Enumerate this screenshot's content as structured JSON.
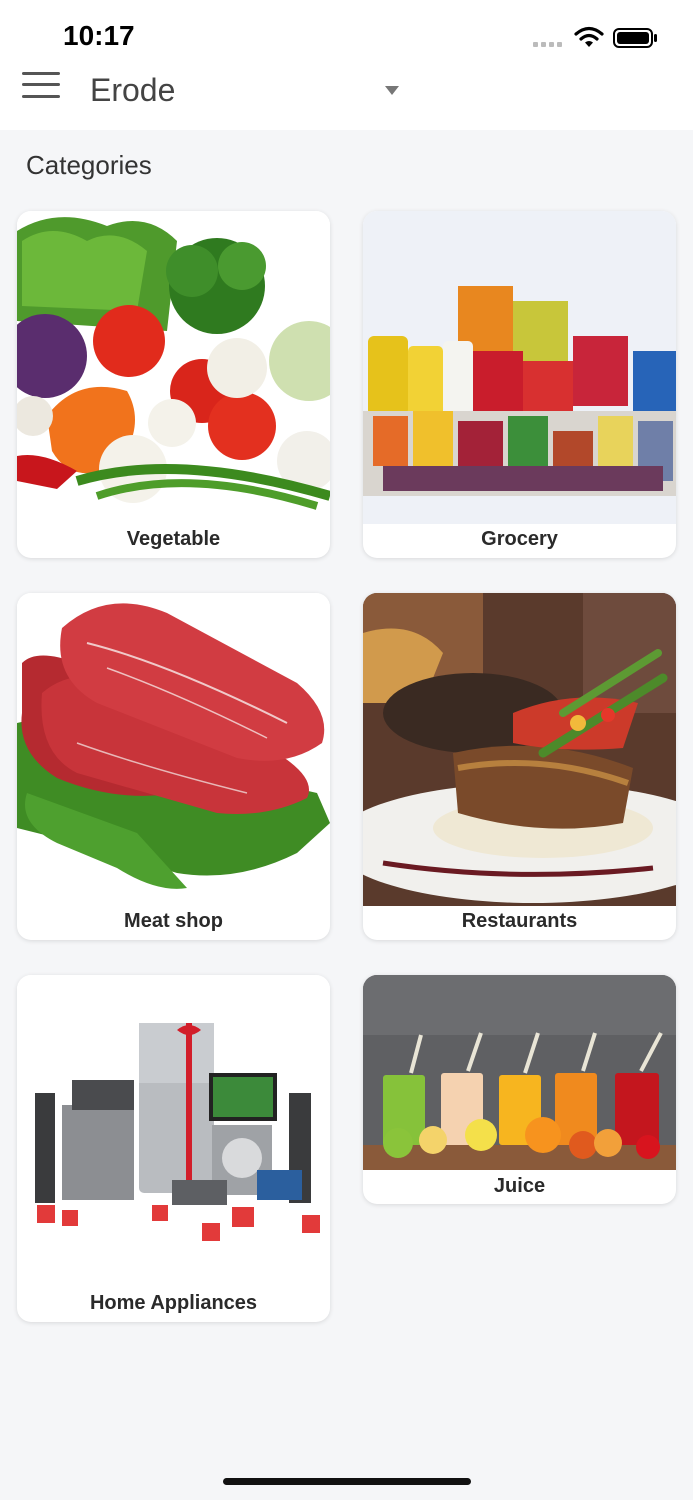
{
  "status_bar": {
    "time": "10:17"
  },
  "header": {
    "city": "Erode"
  },
  "main": {
    "section_title": "Categories",
    "categories": [
      {
        "label": "Vegetable",
        "image": "vegetables-photo"
      },
      {
        "label": "Grocery",
        "image": "grocery-products-photo"
      },
      {
        "label": "Meat shop",
        "image": "raw-meat-photo"
      },
      {
        "label": "Restaurants",
        "image": "plated-dish-photo"
      },
      {
        "label": "Home Appliances",
        "image": "home-appliances-photo"
      },
      {
        "label": "Juice",
        "image": "fruit-juices-photo"
      }
    ]
  },
  "colors": {
    "background": "#f5f6f8",
    "card": "#ffffff",
    "text": "#2a2a2a"
  }
}
